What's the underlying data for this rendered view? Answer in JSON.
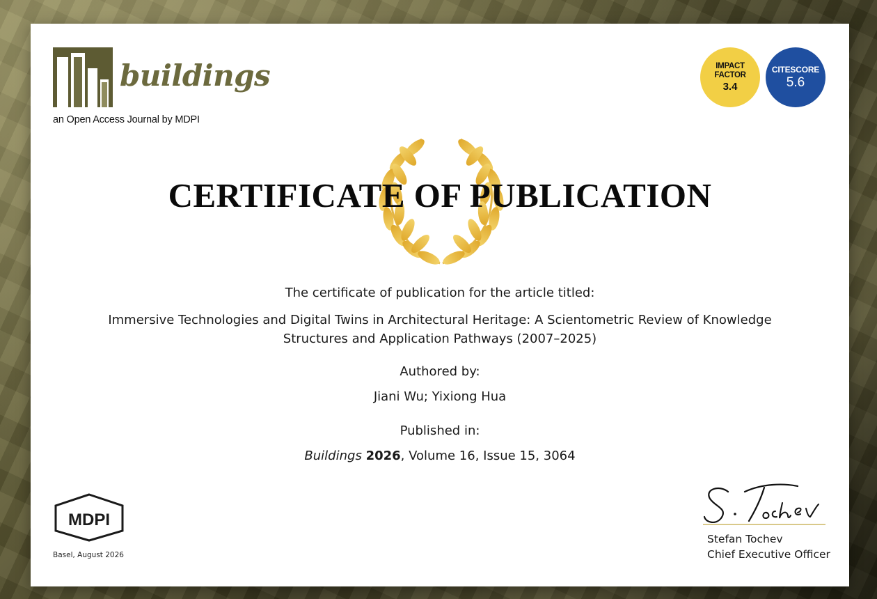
{
  "journal": {
    "name": "buildings",
    "tagline": "an Open Access Journal by MDPI"
  },
  "badges": {
    "impact_factor": {
      "label": "IMPACT FACTOR",
      "value": "3.4",
      "color": "#f2cf45"
    },
    "citescore": {
      "label": "CITESCORE",
      "value": "5.6",
      "color": "#1f4fa0"
    }
  },
  "certificate": {
    "title": "CERTIFICATE OF PUBLICATION",
    "intro": "The certificate of publication for the article titled:",
    "article_title_line1": "Immersive Technologies and Digital Twins in Architectural Heritage: A Scientometric Review of Knowledge",
    "article_title_line2": "Structures and Application Pathways (2007–2025)",
    "authored_label": "Authored by:",
    "authors": "Jiani Wu; Yixiong Hua",
    "published_label": "Published in:",
    "journal_name": "Buildings",
    "year": "2026",
    "details": ", Volume 16, Issue 15, 3064"
  },
  "footer": {
    "publisher": "MDPI",
    "place_date": "Basel, August 2026",
    "signer_name": "Stefan Tochev",
    "signer_role": "Chief Executive Officer"
  },
  "colors": {
    "accent_olive": "#6c6a3e",
    "laurel_gold": "#e9bf3a"
  }
}
